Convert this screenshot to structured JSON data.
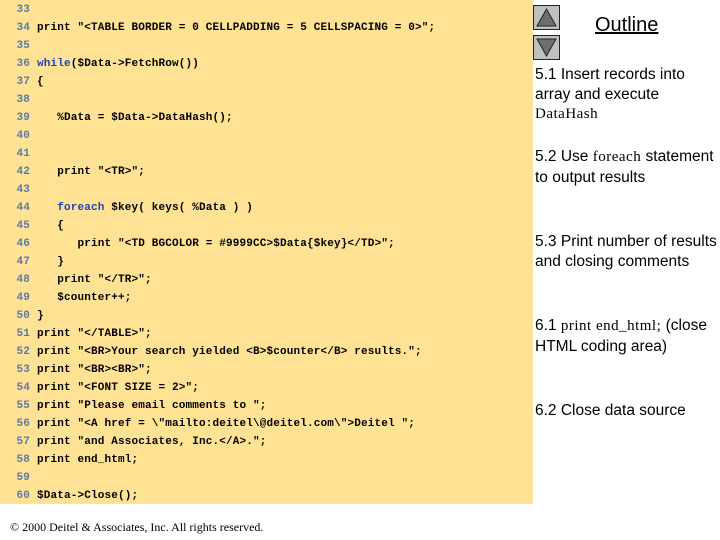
{
  "code": {
    "lines": [
      {
        "num": "33",
        "indent": "",
        "kw": "",
        "text": ""
      },
      {
        "num": "34",
        "indent": "",
        "kw": "",
        "text": "print \"<TABLE BORDER = 0 CELLPADDING = 5 CELLSPACING = 0>\";"
      },
      {
        "num": "35",
        "indent": "",
        "kw": "",
        "text": ""
      },
      {
        "num": "36",
        "indent": "",
        "kw": "while",
        "text": "($Data->FetchRow())"
      },
      {
        "num": "37",
        "indent": "",
        "kw": "",
        "text": "{"
      },
      {
        "num": "38",
        "indent": "",
        "kw": "",
        "text": ""
      },
      {
        "num": "39",
        "indent": "   ",
        "kw": "",
        "text": "%Data = $Data->DataHash();"
      },
      {
        "num": "40",
        "indent": "",
        "kw": "",
        "text": ""
      },
      {
        "num": "41",
        "indent": "",
        "kw": "",
        "text": ""
      },
      {
        "num": "42",
        "indent": "   ",
        "kw": "",
        "text": "print \"<TR>\";"
      },
      {
        "num": "43",
        "indent": "",
        "kw": "",
        "text": ""
      },
      {
        "num": "44",
        "indent": "   ",
        "kw": "foreach",
        "text": " $key( keys( %Data ) )"
      },
      {
        "num": "45",
        "indent": "   ",
        "kw": "",
        "text": "{"
      },
      {
        "num": "46",
        "indent": "      ",
        "kw": "",
        "text": "print \"<TD BGCOLOR = #9999CC>$Data{$key}</TD>\";"
      },
      {
        "num": "47",
        "indent": "   ",
        "kw": "",
        "text": "}"
      },
      {
        "num": "48",
        "indent": "   ",
        "kw": "",
        "text": "print \"</TR>\";"
      },
      {
        "num": "49",
        "indent": "   ",
        "kw": "",
        "text": "$counter++;"
      },
      {
        "num": "50",
        "indent": "",
        "kw": "",
        "text": "}"
      },
      {
        "num": "51",
        "indent": "",
        "kw": "",
        "text": "print \"</TABLE>\";"
      },
      {
        "num": "52",
        "indent": "",
        "kw": "",
        "text": "print \"<BR>Your search yielded <B>$counter</B> results.\";"
      },
      {
        "num": "53",
        "indent": "",
        "kw": "",
        "text": "print \"<BR><BR>\";"
      },
      {
        "num": "54",
        "indent": "",
        "kw": "",
        "text": "print \"<FONT SIZE = 2>\";"
      },
      {
        "num": "55",
        "indent": "",
        "kw": "",
        "text": "print \"Please email comments to \";"
      },
      {
        "num": "56",
        "indent": "",
        "kw": "",
        "text": "print \"<A href = \\\"mailto:deitel\\@deitel.com\\\">Deitel \";"
      },
      {
        "num": "57",
        "indent": "",
        "kw": "",
        "text": "print \"and Associates, Inc.</A>.\";"
      },
      {
        "num": "58",
        "indent": "",
        "kw": "",
        "text": "print end_html;"
      },
      {
        "num": "59",
        "indent": "",
        "kw": "",
        "text": ""
      },
      {
        "num": "60",
        "indent": "",
        "kw": "",
        "text": "$Data->Close();"
      }
    ]
  },
  "nav": {
    "up_icon": "triangle-up-icon",
    "down_icon": "triangle-down-icon"
  },
  "outline": {
    "title": "Outline",
    "items": [
      {
        "prefix": "5.1 Insert records into array and execute ",
        "code": "DataHash",
        "suffix": ""
      },
      {
        "prefix": "5.2 Use ",
        "code": "foreach",
        "suffix": " statement to output results"
      },
      {
        "prefix": "5.3 Print number of results and closing comments",
        "code": "",
        "suffix": ""
      },
      {
        "prefix": "6.1 ",
        "code": "print end_html;",
        "suffix": " (close HTML coding area)"
      },
      {
        "prefix": "6.2 Close data source",
        "code": "",
        "suffix": ""
      }
    ]
  },
  "footer": {
    "text": "© 2000 Deitel & Associates, Inc.  All rights reserved."
  }
}
